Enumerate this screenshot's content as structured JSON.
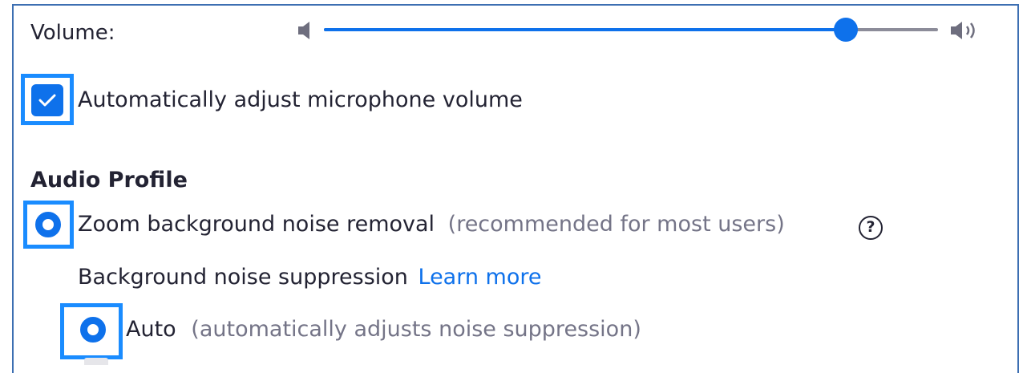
{
  "volume": {
    "label": "Volume:",
    "level_percent": 85,
    "low_icon": "speaker-low-icon",
    "high_icon": "speaker-high-icon"
  },
  "auto_adjust": {
    "label": "Automatically adjust microphone volume",
    "checked": true
  },
  "audio_profile": {
    "title": "Audio Profile",
    "zoom_noise_removal": {
      "label": "Zoom background noise removal",
      "hint": "(recommended for most users)",
      "help_icon": "help-icon",
      "selected": true
    },
    "suppression": {
      "label": "Background noise suppression",
      "learn_more": "Learn more"
    },
    "auto_option": {
      "label": "Auto",
      "hint": "(automatically adjusts noise suppression)",
      "selected": true
    }
  },
  "colors": {
    "accent": "#0e71eb",
    "highlight": "#1a8cff",
    "frame": "#3d6fb2",
    "text": "#232333",
    "muted": "#747487"
  }
}
